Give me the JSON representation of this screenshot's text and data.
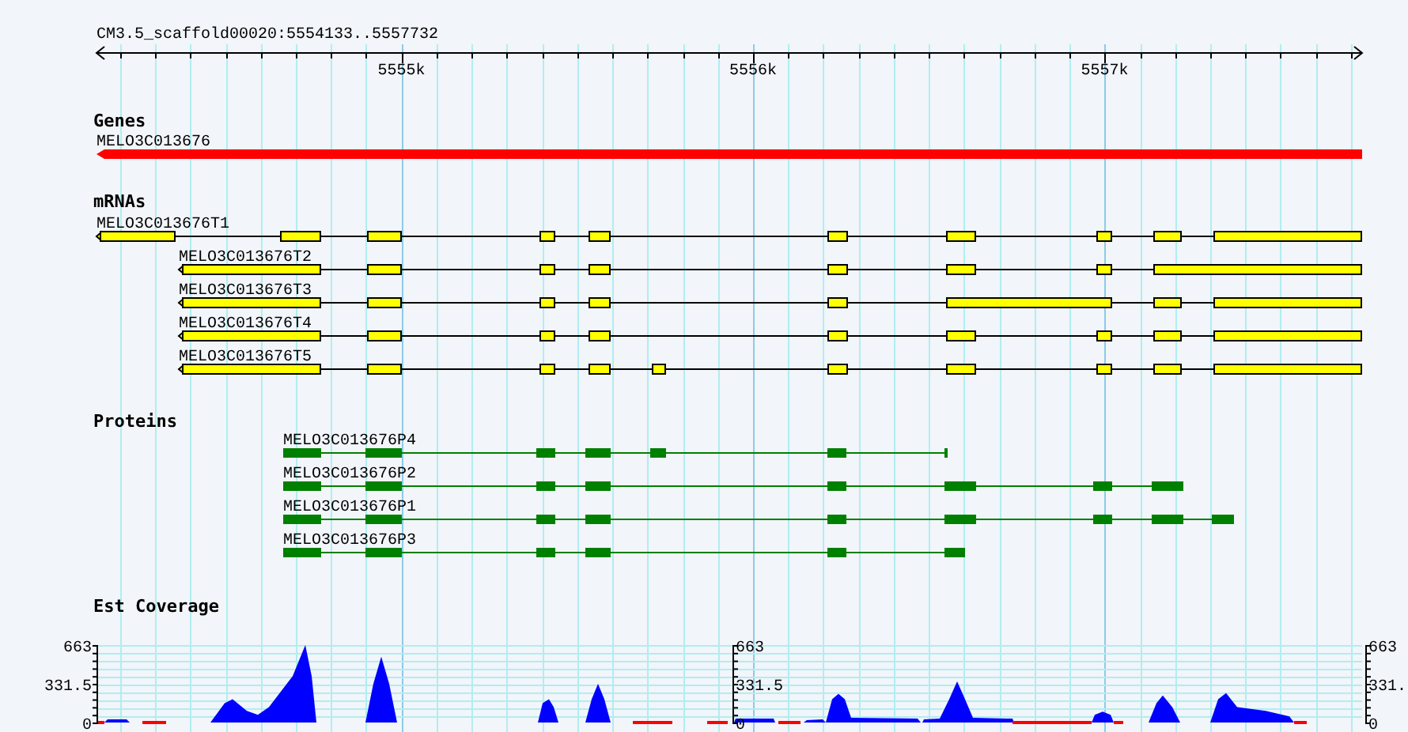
{
  "ruler": {
    "label": "CM3.5_scaffold00020:5554133..5557732",
    "ticks": [
      "5555k",
      "5556k",
      "5557k"
    ]
  },
  "tracks": [
    {
      "kind": "gene",
      "title": "Genes",
      "features": [
        {
          "label": "MELO3C013676"
        }
      ]
    },
    {
      "kind": "mrna",
      "title": "mRNAs",
      "features": [
        {
          "label": "MELO3C013676T1"
        },
        {
          "label": "MELO3C013676T2"
        },
        {
          "label": "MELO3C013676T3"
        },
        {
          "label": "MELO3C013676T4"
        },
        {
          "label": "MELO3C013676T5"
        }
      ]
    },
    {
      "kind": "protein",
      "title": "Proteins",
      "features": [
        {
          "label": "MELO3C013676P4"
        },
        {
          "label": "MELO3C013676P2"
        },
        {
          "label": "MELO3C013676P1"
        },
        {
          "label": "MELO3C013676P3"
        }
      ]
    },
    {
      "kind": "coverage",
      "title": "Est Coverage",
      "axes": [
        {
          "ticks": [
            "663",
            "331.5",
            "0"
          ]
        },
        {
          "ticks": [
            "663",
            "331.5",
            "0"
          ]
        },
        {
          "ticks": [
            "663",
            "331.",
            "0"
          ]
        }
      ]
    }
  ]
}
